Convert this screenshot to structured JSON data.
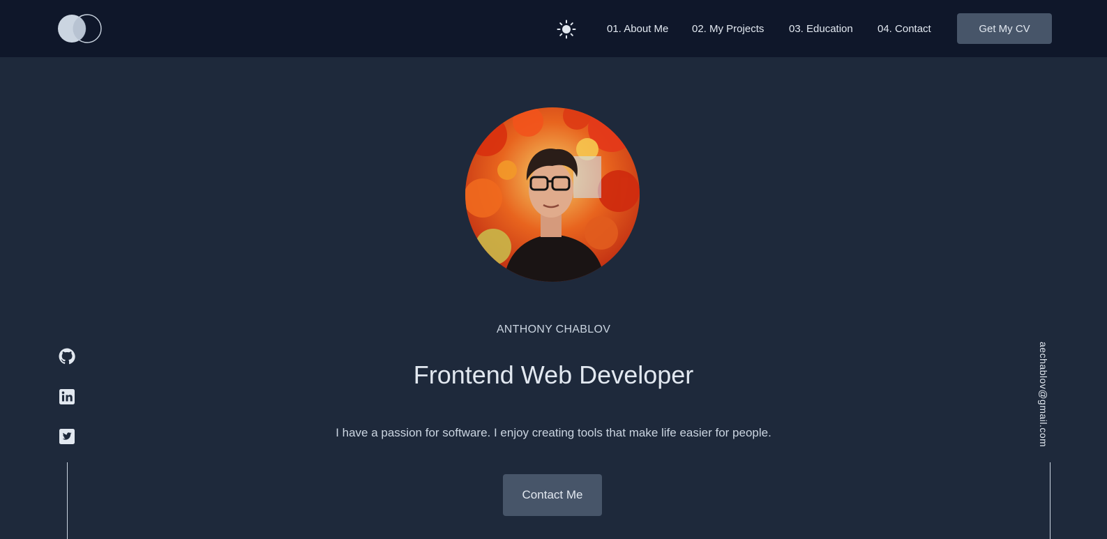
{
  "nav": {
    "links": [
      "01. About Me",
      "02. My Projects",
      "03. Education",
      "04. Contact"
    ],
    "cv_label": "Get My CV"
  },
  "hero": {
    "name": "ANTHONY CHABLOV",
    "title": "Frontend Web Developer",
    "description": "I have a passion for software. I enjoy creating tools that make life easier for people.",
    "contact_label": "Contact Me"
  },
  "social": {
    "icons": [
      "github-icon",
      "linkedin-icon",
      "twitter-icon"
    ]
  },
  "email": "aechablov@gmail.com",
  "colors": {
    "background": "#1e293b",
    "navbar": "#0f172a",
    "button": "#475569",
    "text": "#cbd5e1"
  }
}
